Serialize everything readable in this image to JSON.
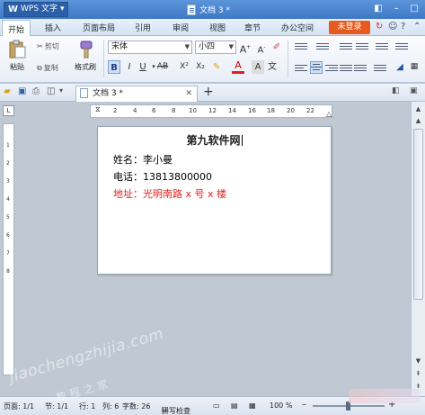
{
  "app": {
    "name": "WPS 文字",
    "doc_title": "文档 3 *"
  },
  "tabs": [
    {
      "label": "开始"
    },
    {
      "label": "插入"
    },
    {
      "label": "页面布局"
    },
    {
      "label": "引用"
    },
    {
      "label": "审阅"
    },
    {
      "label": "视图"
    },
    {
      "label": "章节"
    },
    {
      "label": "办公空间"
    }
  ],
  "login_label": "未登录",
  "ribbon": {
    "paste": "粘贴",
    "cut": "剪切",
    "copy": "复制",
    "format_painter": "格式刷",
    "font_name": "宋体",
    "font_size": "小四"
  },
  "doc_tab": {
    "label": "文档 3 *"
  },
  "ruler_marks": [
    "2",
    "4",
    "6",
    "8",
    "10",
    "12",
    "14",
    "16",
    "18",
    "20",
    "22"
  ],
  "vruler_marks": [
    "1",
    "2",
    "3",
    "4",
    "5",
    "6",
    "7",
    "8"
  ],
  "document": {
    "title": "第九软件网",
    "lines": [
      {
        "text": "姓名：李小曼",
        "color": "#000000"
      },
      {
        "text": "电话：13813800000",
        "color": "#000000"
      },
      {
        "text": "地址：光明南路 x 号 x 楼",
        "color": "#e02020"
      }
    ]
  },
  "status": {
    "page": "页面: 1/1",
    "section": "节: 1/1",
    "row": "行: 1",
    "col": "列: 6",
    "words": "字数: 26",
    "spell": "拼写检查",
    "zoom": "100 %"
  },
  "watermark": {
    "url": "jiaochengzhijia.com",
    "cn": "教 程 之 家"
  }
}
